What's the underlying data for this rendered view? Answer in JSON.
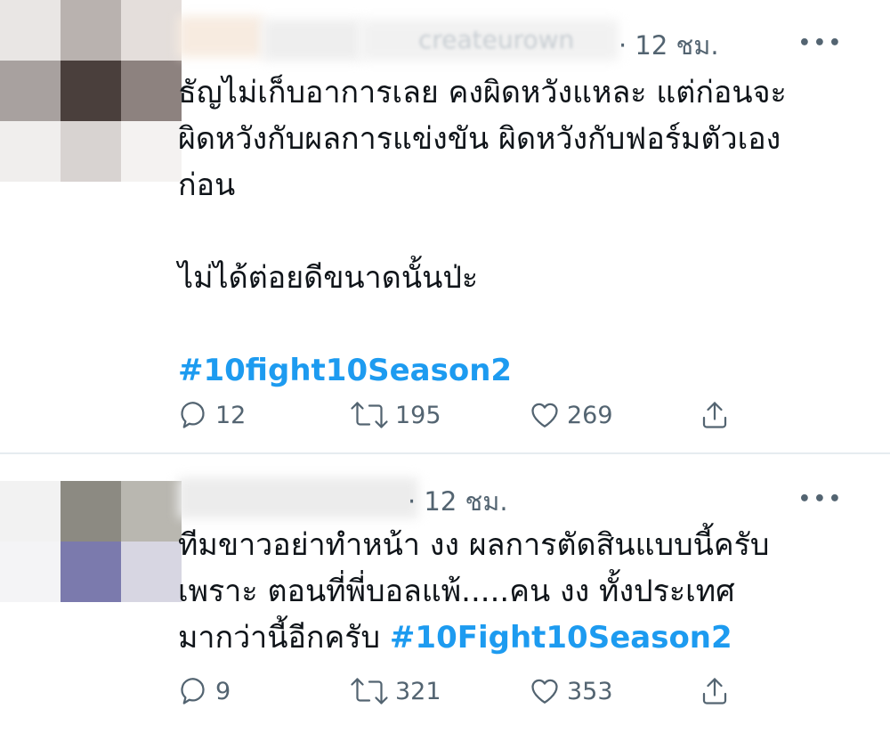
{
  "tweets": [
    {
      "time": "· 12 ชม.",
      "handle_fragment": "createurown",
      "more_label": "•••",
      "lines": [
        "ธัญไม่เก็บอาการเลย คงผิดหวังแหละ แต่ก่อนจะ",
        "ผิดหวังกับผลการแข่งขัน ผิดหวังกับฟอร์มตัวเอง",
        "ก่อน",
        "ไม่ได้ต่อยดีขนาดนั้นป่ะ"
      ],
      "hashtag": "#10fight10Season2",
      "replies": "12",
      "retweets": "195",
      "likes": "269"
    },
    {
      "time": "· 12 ชม.",
      "more_label": "•••",
      "lines": [
        "ทีมขาวอย่าทำหน้า งง ผลการตัดสินแบบนี้ครับ",
        "เพราะ ตอนที่พี่บอลแพ้.....คน งง ทั้งประเทศ",
        "มากว่านี้อีกครับ"
      ],
      "hashtag": "#10Fight10Season2",
      "replies": "9",
      "retweets": "321",
      "likes": "353"
    }
  ],
  "colors": {
    "text": "#0f1419",
    "muted": "#536471",
    "link": "#1d9bf0",
    "divider": "#e6ecf0"
  },
  "icons": {
    "reply": "reply-icon",
    "retweet": "retweet-icon",
    "like": "like-icon",
    "share": "share-icon",
    "more": "more-icon"
  }
}
